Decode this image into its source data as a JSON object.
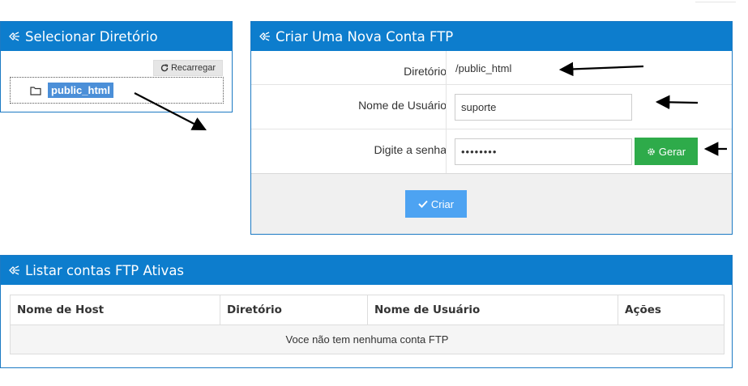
{
  "select_dir": {
    "title": "Selecionar Diretório",
    "reload_label": "Recarregar",
    "tree_item": "public_html"
  },
  "new_account": {
    "title": "Criar Uma Nova Conta FTP",
    "dir_label": "Diretório",
    "dir_value": "/public_html",
    "user_label": "Nome de Usuário",
    "user_value": "suporte",
    "pass_label": "Digite a senha",
    "pass_value": "••••••••",
    "generate_label": "Gerar",
    "create_label": "Criar"
  },
  "list": {
    "title": "Listar contas FTP Ativas",
    "columns": [
      "Nome de Host",
      "Diretório",
      "Nome de Usuário",
      "Ações"
    ],
    "empty_text": "Voce não tem nenhuma conta FTP"
  },
  "colors": {
    "header_blue": "#0d7dcd",
    "generate_green": "#2eab4a",
    "create_blue": "#4da3f2",
    "selected_blue": "#4b8fd8"
  },
  "icons": {
    "panel_header": "plug-icon",
    "reload": "refresh-icon",
    "folder": "folder-icon",
    "generate": "gear-icon",
    "create": "check-icon"
  }
}
